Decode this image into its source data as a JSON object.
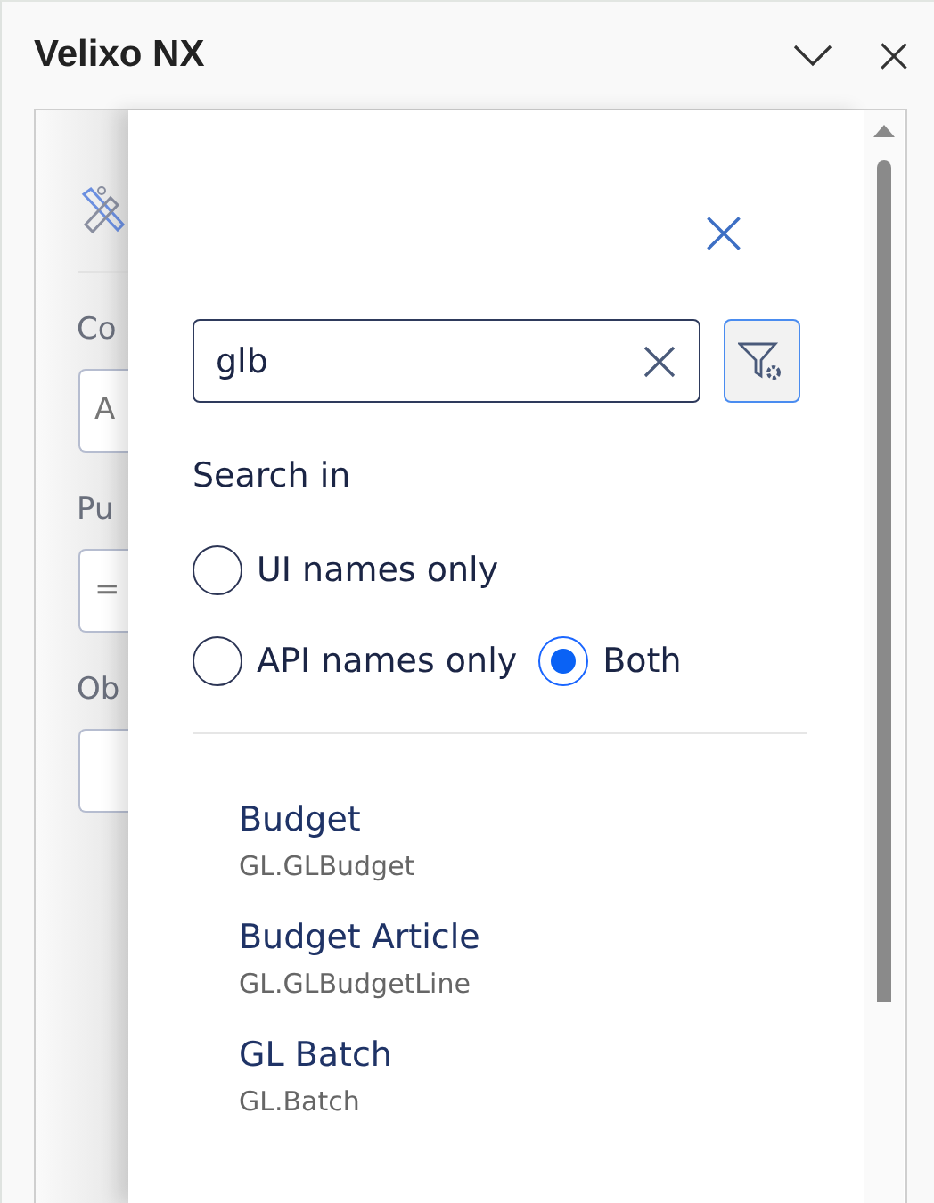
{
  "window": {
    "title": "Velixo NX"
  },
  "background_form": {
    "labels": [
      "Co",
      "Pu",
      "Ob"
    ],
    "fields": [
      "A",
      "="
    ]
  },
  "search_panel": {
    "search": {
      "value": "glb"
    },
    "search_in": {
      "label": "Search in",
      "rows": [
        [
          {
            "label": "UI names only",
            "selected": false
          }
        ],
        [
          {
            "label": "API names only",
            "selected": false
          },
          {
            "label": "Both",
            "selected": true
          }
        ]
      ]
    },
    "results": [
      {
        "title": "Budget",
        "api_name": "GL.GLBudget"
      },
      {
        "title": "Budget Article",
        "api_name": "GL.GLBudgetLine"
      },
      {
        "title": "GL Batch",
        "api_name": "GL.Batch"
      }
    ]
  }
}
